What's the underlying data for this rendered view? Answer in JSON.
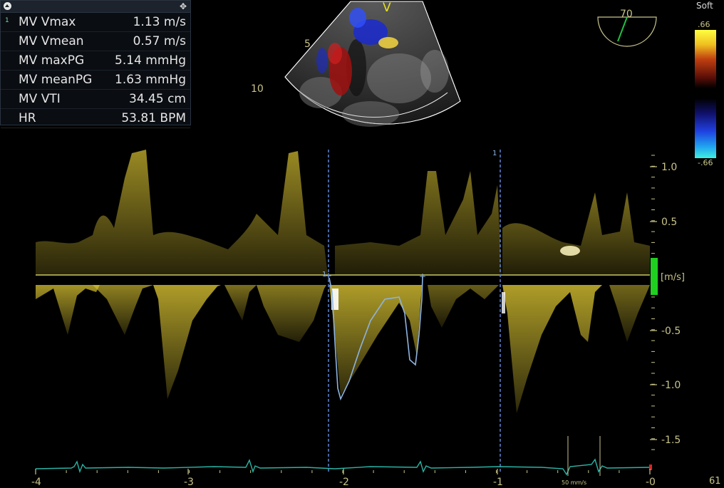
{
  "measurements": [
    {
      "index": "1",
      "label": "MV Vmax",
      "value": "1.13 m/s"
    },
    {
      "index": "",
      "label": "MV Vmean",
      "value": "0.57 m/s"
    },
    {
      "index": "",
      "label": "MV maxPG",
      "value": "5.14 mmHg"
    },
    {
      "index": "",
      "label": "MV meanPG",
      "value": "1.63 mmHg"
    },
    {
      "index": "",
      "label": "MV VTI",
      "value": "34.45 cm"
    },
    {
      "index": "",
      "label": "HR",
      "value": "53.81 BPM"
    }
  ],
  "sector": {
    "marker": "V",
    "depth_labels": [
      "5",
      "10"
    ]
  },
  "probe_angle": {
    "value": "70"
  },
  "color_map": {
    "label": "Soft",
    "top": ".66",
    "bottom": "-.66"
  },
  "velocity_axis": {
    "ticks": [
      "1.0",
      "0.5",
      "-0.5",
      "-1.0",
      "-1.5"
    ],
    "unit": "[m/s]"
  },
  "time_axis": {
    "ticks": [
      "-4",
      "-3",
      "-2",
      "-1",
      "-0"
    ]
  },
  "caliper_labels": {
    "start": "1",
    "end": "1"
  },
  "sweep_speed": "50 mm/s",
  "frame_rate": "61",
  "colors": {
    "doppler": "#d8c232",
    "ecg": "#2bb3a4",
    "baseline": "#c9c864",
    "trace": "#8fb3e0",
    "caliper": "#5f86d6",
    "scale_text": "#c9c48a"
  }
}
